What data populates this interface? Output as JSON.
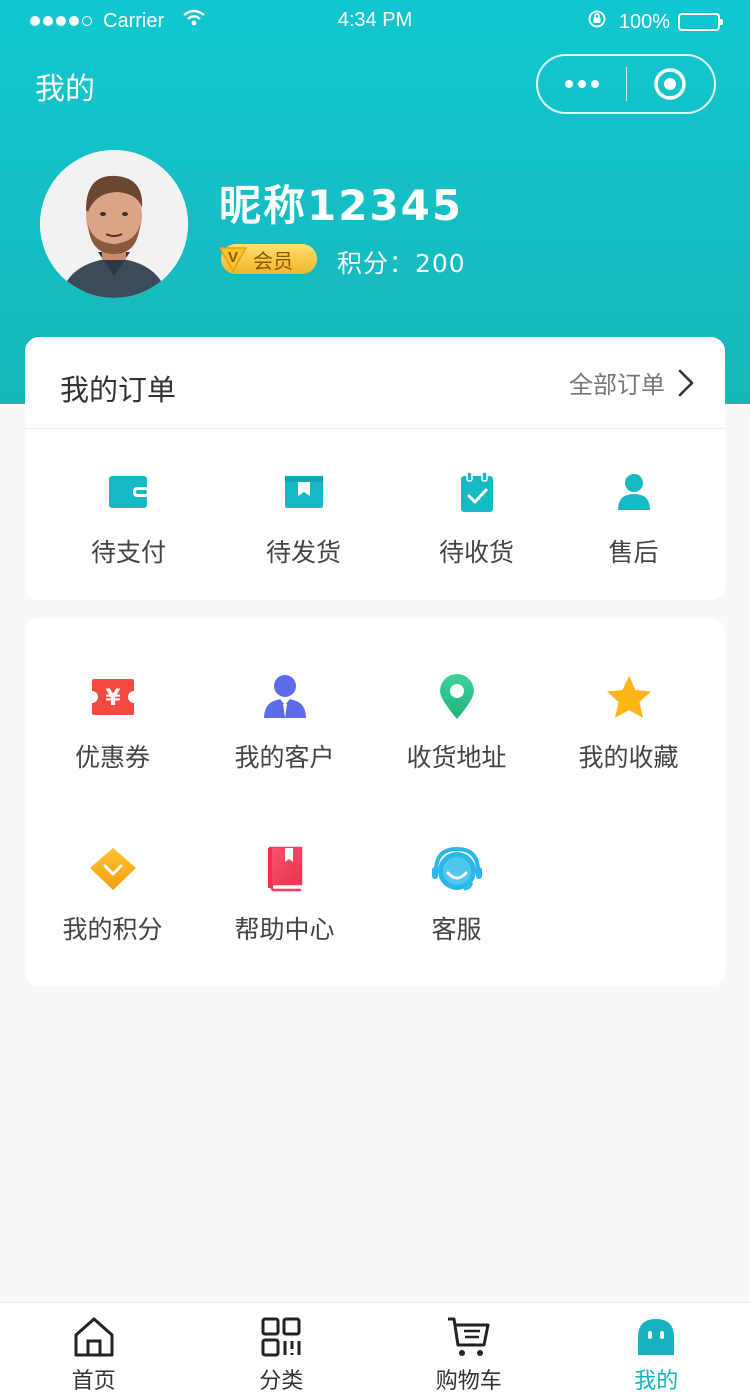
{
  "status_bar": {
    "carrier": "Carrier",
    "time": "4:34 PM",
    "battery": "100%"
  },
  "nav": {
    "title": "我的"
  },
  "profile": {
    "nickname": "昵称12345",
    "vip_label": "会员",
    "points_text": "积分：200"
  },
  "orders": {
    "title": "我的订单",
    "all_label": "全部订单",
    "items": [
      {
        "label": "待支付",
        "icon": "wallet-icon"
      },
      {
        "label": "待发货",
        "icon": "box-icon"
      },
      {
        "label": "待收货",
        "icon": "clipboard-check-icon"
      },
      {
        "label": "售后",
        "icon": "user-icon"
      }
    ]
  },
  "services": {
    "items": [
      {
        "label": "优惠券",
        "icon": "coupon-icon"
      },
      {
        "label": "我的客户",
        "icon": "customer-icon"
      },
      {
        "label": "收货地址",
        "icon": "location-pin-icon"
      },
      {
        "label": "我的收藏",
        "icon": "star-icon"
      },
      {
        "label": "我的积分",
        "icon": "diamond-icon"
      },
      {
        "label": "帮助中心",
        "icon": "book-icon"
      },
      {
        "label": "客服",
        "icon": "headset-icon"
      }
    ]
  },
  "tabbar": {
    "items": [
      {
        "label": "首页",
        "icon": "home-icon"
      },
      {
        "label": "分类",
        "icon": "category-icon"
      },
      {
        "label": "购物车",
        "icon": "cart-icon"
      },
      {
        "label": "我的",
        "icon": "profile-icon"
      }
    ],
    "active_color": "#17b3bf"
  },
  "colors": {
    "header": "#14c0c6",
    "accent": "#17b3bf"
  }
}
